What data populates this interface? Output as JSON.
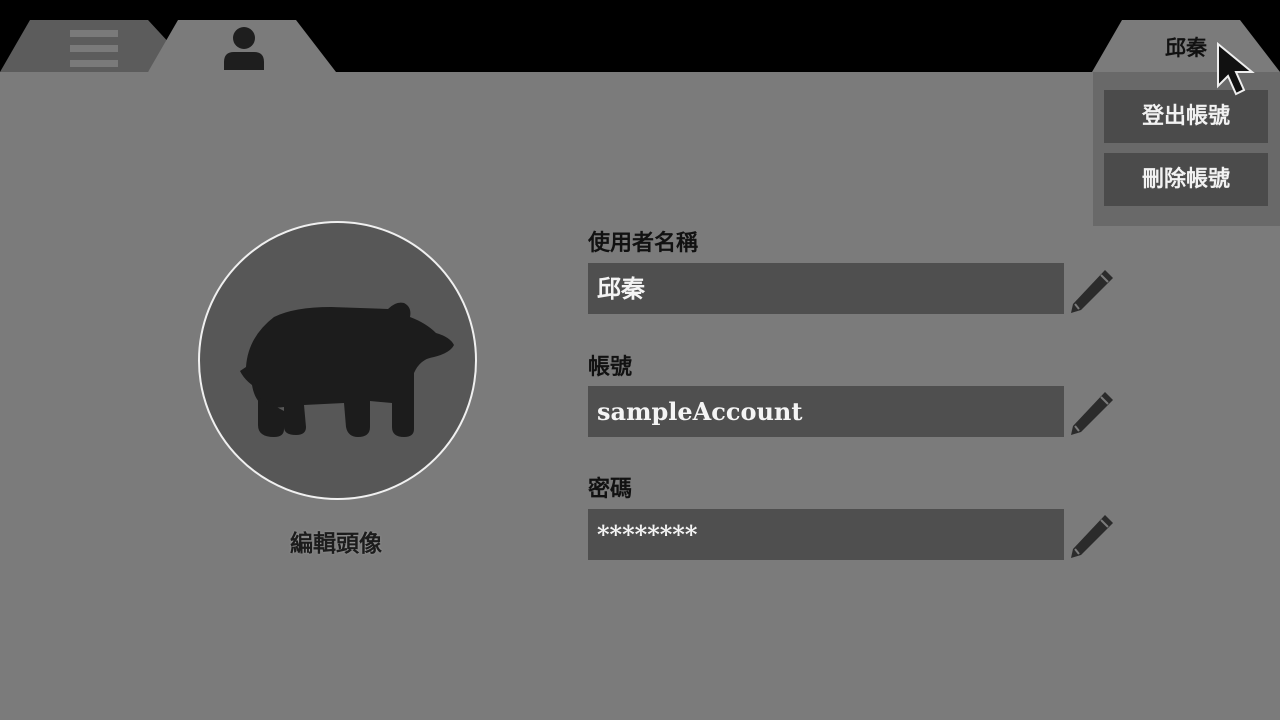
{
  "header": {
    "tabs": [
      {
        "id": "menu",
        "icon": "hamburger-menu-icon"
      },
      {
        "id": "profile",
        "icon": "user-icon"
      }
    ],
    "user_tab": {
      "label": "邱秦"
    }
  },
  "dropdown": {
    "items": [
      {
        "label": "登出帳號"
      },
      {
        "label": "刪除帳號"
      }
    ]
  },
  "avatar": {
    "icon": "bear-icon",
    "edit_label": "編輯頭像"
  },
  "form": {
    "fields": [
      {
        "label": "使用者名稱",
        "value": "邱秦",
        "edit_icon": "pencil-icon"
      },
      {
        "label": "帳號",
        "value": "sampleAccount",
        "edit_icon": "pencil-icon"
      },
      {
        "label": "密碼",
        "value": "********",
        "edit_icon": "pencil-icon"
      }
    ]
  },
  "colors": {
    "background": "#7b7b7b",
    "topbar": "#000000",
    "tab": "#7b7b7b",
    "field": "#4f4f4f",
    "dropdown_button": "#4b4b4b"
  }
}
